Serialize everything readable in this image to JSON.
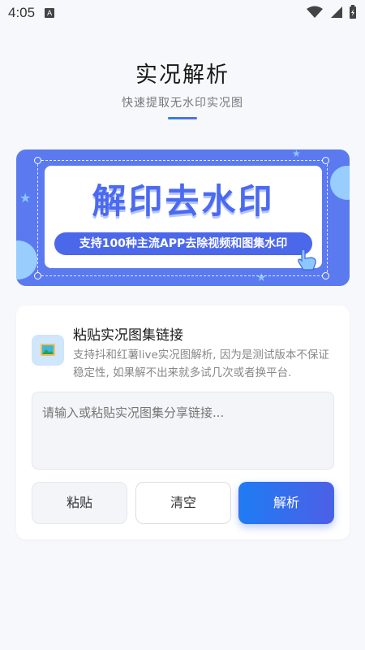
{
  "status_bar": {
    "time": "4:05",
    "notification_letter": "A"
  },
  "header": {
    "title": "实况解析",
    "subtitle": "快速提取无水印实况图"
  },
  "banner": {
    "headline": "解印去水印",
    "tagline": "支持100种主流APP去除视频和图集水印"
  },
  "card": {
    "heading": "粘贴实况图集链接",
    "description": "支持抖和红薯live实况图解析, 因为是测试版本不保证稳定性, 如果解不出来就多试几次或者换平台.",
    "input": {
      "placeholder": "请输入或粘贴实况图集分享链接...",
      "value": ""
    },
    "buttons": {
      "paste": "粘贴",
      "clear": "清空",
      "parse": "解析"
    }
  },
  "colors": {
    "accent": "#1e7cf3",
    "accent_end": "#4d5fe6",
    "banner_bg": "#5b7af0",
    "page_bg": "#f7f8fb"
  }
}
